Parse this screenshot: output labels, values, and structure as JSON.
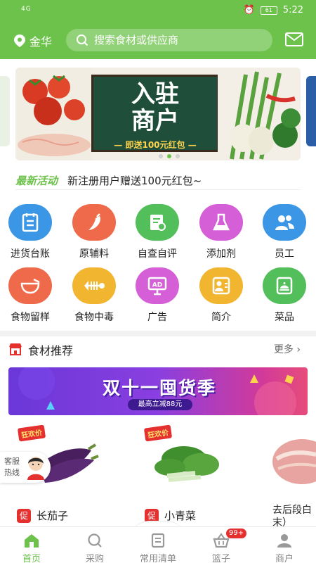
{
  "status_bar": {
    "network": "4G",
    "battery": "61",
    "time": "5:22"
  },
  "header": {
    "location": "金华",
    "search_placeholder": "搜索食材或供应商"
  },
  "banner": {
    "line1": "入驻",
    "line2": "商户",
    "line3": "— 即送100元红包 —",
    "dots": 3,
    "active_dot": 1
  },
  "news": {
    "tag": "最新活动",
    "text": "新注册用户赠送100元红包~"
  },
  "grid": {
    "items": [
      {
        "label": "进货台账",
        "color": "#3b97e6",
        "icon": "ledger-icon"
      },
      {
        "label": "原辅料",
        "color": "#ee6a4a",
        "icon": "pepper-icon"
      },
      {
        "label": "自查自评",
        "color": "#52bf5a",
        "icon": "inspect-icon"
      },
      {
        "label": "添加剂",
        "color": "#d45fd6",
        "icon": "flask-icon"
      },
      {
        "label": "员工",
        "color": "#3b97e6",
        "icon": "staff-icon"
      },
      {
        "label": "食物留样",
        "color": "#ee6a4a",
        "icon": "bowl-icon"
      },
      {
        "label": "食物中毒",
        "color": "#f2b530",
        "icon": "fishbone-icon"
      },
      {
        "label": "广告",
        "color": "#d45fd6",
        "icon": "ad-icon"
      },
      {
        "label": "简介",
        "color": "#f2b530",
        "icon": "profile-icon"
      },
      {
        "label": "菜品",
        "color": "#52bf5a",
        "icon": "dish-icon"
      }
    ]
  },
  "recommend": {
    "title": "食材推荐",
    "more": "更多"
  },
  "promo": {
    "title": "双十一囤货季",
    "subtitle": "最高立减88元"
  },
  "products": [
    {
      "badge": "狂欢价",
      "tag": "促",
      "name": "长茄子"
    },
    {
      "badge": "狂欢价",
      "tag": "促",
      "name": "小青菜"
    },
    {
      "name": "去后段白\n末）"
    }
  ],
  "service": {
    "label": "客服热线"
  },
  "tabbar": {
    "items": [
      {
        "label": "首页",
        "active": true
      },
      {
        "label": "采购"
      },
      {
        "label": "常用清单"
      },
      {
        "label": "篮子",
        "badge": "99+"
      },
      {
        "label": "商户"
      }
    ]
  },
  "theme": {
    "primary": "#6cc24a",
    "accent_red": "#e53030"
  }
}
